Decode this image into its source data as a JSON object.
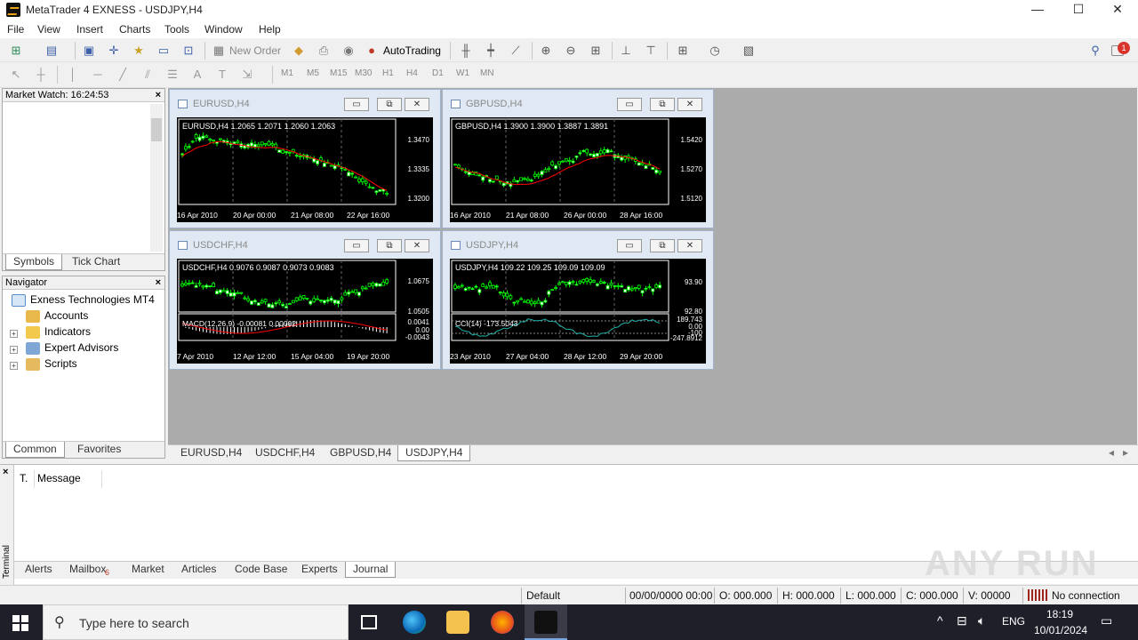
{
  "window": {
    "title": "MetaTrader 4 EXNESS - USDJPY,H4",
    "minimize": "—",
    "maximize": "☐",
    "close": "✕"
  },
  "menu": [
    "File",
    "View",
    "Insert",
    "Charts",
    "Tools",
    "Window",
    "Help"
  ],
  "toolbar": {
    "new_order": "New Order",
    "auto_trading": "AutoTrading",
    "notif_count": "1"
  },
  "timeframes": [
    "M1",
    "M5",
    "M15",
    "M30",
    "H1",
    "H4",
    "D1",
    "W1",
    "MN"
  ],
  "market_watch": {
    "title": "Market Watch: 16:24:53",
    "tabs": [
      "Symbols",
      "Tick Chart"
    ]
  },
  "navigator": {
    "title": "Navigator",
    "root": "Exness Technologies MT4",
    "items": [
      "Accounts",
      "Indicators",
      "Expert Advisors",
      "Scripts"
    ],
    "tabs": [
      "Common",
      "Favorites"
    ]
  },
  "charts": [
    {
      "title": "EURUSD,H4",
      "label": "EURUSD,H4  1.2065  1.2071  1.2060  1.2063",
      "prices": [
        "1.3470",
        "1.3335",
        "1.3200"
      ],
      "dates": [
        "16 Apr 2010",
        "20 Apr 00:00",
        "21 Apr 08:00",
        "22 Apr 16:00"
      ]
    },
    {
      "title": "GBPUSD,H4",
      "label": "GBPUSD,H4  1.3900  1.3900  1.3887  1.3891",
      "prices": [
        "1.5420",
        "1.5270",
        "1.5120"
      ],
      "dates": [
        "16 Apr 2010",
        "21 Apr 08:00",
        "26 Apr 00:00",
        "28 Apr 16:00"
      ]
    },
    {
      "title": "USDCHF,H4",
      "label": "USDCHF,H4  0.9076  0.9087  0.9073  0.9083",
      "prices": [
        "1.0675",
        "1.0505"
      ],
      "sub_label": "MACD(12,26,9) -0.00081 0.00002",
      "sub_prices": [
        "0.0041",
        "0.00",
        "-0.0043"
      ],
      "dates": [
        "7 Apr 2010",
        "12 Apr 12:00",
        "15 Apr 04:00",
        "19 Apr 20:00"
      ]
    },
    {
      "title": "USDJPY,H4",
      "label": "USDJPY,H4  109.22  109.25  109.09  109.09",
      "prices": [
        "93.90",
        "92.80"
      ],
      "sub_label": "CCI(14) -173.5043",
      "sub_prices": [
        "189.743",
        "0.00",
        "-100",
        "-247.8912"
      ],
      "dates": [
        "23 Apr 2010",
        "27 Apr 04:00",
        "28 Apr 12:00",
        "29 Apr 20:00"
      ]
    }
  ],
  "chart_tabs": [
    "EURUSD,H4",
    "USDCHF,H4",
    "GBPUSD,H4",
    "USDJPY,H4"
  ],
  "terminal": {
    "label": "Terminal",
    "columns": [
      "T.",
      "Message"
    ],
    "tabs": [
      "Alerts",
      "Mailbox",
      "Market",
      "Articles",
      "Code Base",
      "Experts",
      "Journal"
    ],
    "mailbox_badge": "6"
  },
  "status": {
    "profile": "Default",
    "datetime": "00/00/0000 00:00",
    "open": "O: 000.000",
    "high": "H: 000.000",
    "low": "L: 000.000",
    "close": "C: 000.000",
    "volume": "V: 00000",
    "connection": "No connection"
  },
  "watermark": "ANY RUN",
  "taskbar": {
    "search_placeholder": "Type here to search",
    "lang": "ENG",
    "time": "18:19",
    "date": "10/01/2024"
  },
  "colors": {
    "bull": "#00ff00",
    "bear": "#ffffff",
    "ma": "#ff0000",
    "indicator": "#20b2aa"
  }
}
